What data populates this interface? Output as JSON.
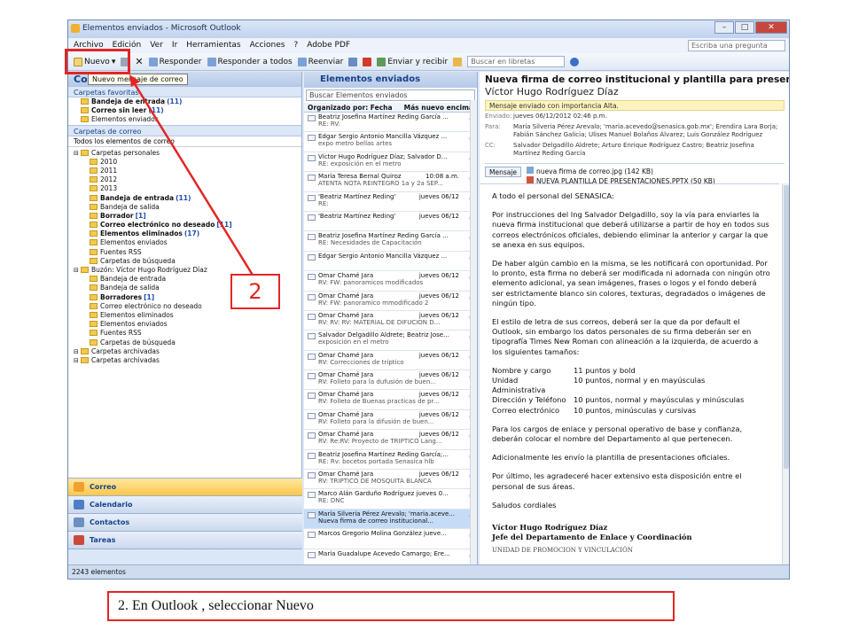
{
  "window": {
    "title": "Elementos enviados - Microsoft Outlook",
    "menu": [
      "Archivo",
      "Edición",
      "Ver",
      "Ir",
      "Herramientas",
      "Acciones",
      "?",
      "Adobe PDF"
    ],
    "ask_placeholder": "Escriba una pregunta"
  },
  "toolbar": {
    "new_label": "Nuevo",
    "reply_label": "Responder",
    "reply_all_label": "Responder a todos",
    "forward_label": "Reenviar",
    "send_receive_label": "Enviar y recibir",
    "search_books_placeholder": "Buscar en libretas",
    "tooltip": "Nuevo mensaje de correo"
  },
  "nav": {
    "header": "Correo",
    "favorites_header": "Carpetas favoritas",
    "favorites": [
      {
        "label": "Bandeja de entrada",
        "count": "(11)"
      },
      {
        "label": "Correo sin leer",
        "count": "(11)"
      },
      {
        "label": "Elementos enviados",
        "count": ""
      }
    ],
    "mail_header": "Carpetas de correo",
    "all_items": "Todos los elementos de correo",
    "tree": [
      {
        "label": "Carpetas personales",
        "indent": 1,
        "bold": false,
        "count": ""
      },
      {
        "label": "2010",
        "indent": 2,
        "bold": false,
        "count": ""
      },
      {
        "label": "2011",
        "indent": 2,
        "bold": false,
        "count": ""
      },
      {
        "label": "2012",
        "indent": 2,
        "bold": false,
        "count": ""
      },
      {
        "label": "2013",
        "indent": 2,
        "bold": false,
        "count": ""
      },
      {
        "label": "Bandeja de entrada",
        "indent": 2,
        "bold": true,
        "count": "(11)"
      },
      {
        "label": "Bandeja de salida",
        "indent": 2,
        "bold": false,
        "count": ""
      },
      {
        "label": "Borrador",
        "indent": 2,
        "bold": true,
        "count": "[1]"
      },
      {
        "label": "Correo electrónico no deseado",
        "indent": 2,
        "bold": true,
        "count": "[11]"
      },
      {
        "label": "Elementos eliminados",
        "indent": 2,
        "bold": true,
        "count": "(17)"
      },
      {
        "label": "Elementos enviados",
        "indent": 2,
        "bold": false,
        "count": ""
      },
      {
        "label": "Fuentes RSS",
        "indent": 2,
        "bold": false,
        "count": ""
      },
      {
        "label": "Carpetas de búsqueda",
        "indent": 2,
        "bold": false,
        "count": ""
      },
      {
        "label": "Buzón: Víctor Hugo Rodríguez Díaz",
        "indent": 1,
        "bold": false,
        "count": ""
      },
      {
        "label": "Bandeja de entrada",
        "indent": 2,
        "bold": false,
        "count": ""
      },
      {
        "label": "Bandeja de salida",
        "indent": 2,
        "bold": false,
        "count": ""
      },
      {
        "label": "Borradores",
        "indent": 2,
        "bold": true,
        "count": "[1]"
      },
      {
        "label": "Correo electrónico no deseado",
        "indent": 2,
        "bold": false,
        "count": ""
      },
      {
        "label": "Elementos eliminados",
        "indent": 2,
        "bold": false,
        "count": ""
      },
      {
        "label": "Elementos enviados",
        "indent": 2,
        "bold": false,
        "count": ""
      },
      {
        "label": "Fuentes RSS",
        "indent": 2,
        "bold": false,
        "count": ""
      },
      {
        "label": "Carpetas de búsqueda",
        "indent": 2,
        "bold": false,
        "count": ""
      },
      {
        "label": "Carpetas archivadas",
        "indent": 1,
        "bold": false,
        "count": ""
      },
      {
        "label": "Carpetas archivadas",
        "indent": 1,
        "bold": false,
        "count": ""
      }
    ],
    "buttons": [
      {
        "label": "Correo",
        "color": "#f0a030"
      },
      {
        "label": "Calendario",
        "color": "#4d7fc6"
      },
      {
        "label": "Contactos",
        "color": "#6c8fbf"
      },
      {
        "label": "Tareas",
        "color": "#c94a3a"
      }
    ]
  },
  "list": {
    "header": "Elementos enviados",
    "search_placeholder": "Buscar Elementos enviados",
    "arrange_by": "Organizado por: Fecha",
    "sort": "Más nuevo encima",
    "messages": [
      {
        "from": "Beatriz Josefina Martínez Reding García ...",
        "date": "",
        "subject": "RE: RV:"
      },
      {
        "from": "Edgar Sergio Antonio Mancilla Vázquez ...",
        "date": "",
        "subject": "expo metro bellas artes"
      },
      {
        "from": "Víctor Hugo Rodríguez Díaz; Salvador D...",
        "date": "",
        "subject": "RE: exposición en el metro"
      },
      {
        "from": "María Teresa Bernal Quiroz",
        "date": "10:08 a.m.",
        "subject": "ATENTA NOTA REINTEGRO 1a y 2a SEP..."
      },
      {
        "from": "'Beatriz Martínez Reding'",
        "date": "jueves 06/12",
        "subject": "RE:"
      },
      {
        "from": "'Beatriz Martínez Reding'",
        "date": "jueves 06/12",
        "subject": ""
      },
      {
        "from": "Beatriz Josefina Martínez Reding García ...",
        "date": "",
        "subject": "RE: Necesidades de Capacitación"
      },
      {
        "from": "Edgar Sergio Antonio Mancilla Vázquez ...",
        "date": "",
        "subject": ""
      },
      {
        "from": "Omar Chamé Jara",
        "date": "jueves 06/12",
        "subject": "RV: FW: panoramicos modificados"
      },
      {
        "from": "Omar Chamé Jara",
        "date": "jueves 06/12",
        "subject": "RV: FW: panoramico mmodificado 2"
      },
      {
        "from": "Omar Chamé Jara",
        "date": "jueves 06/12",
        "subject": "RV: RV: RV: MATERIAL DE DIFUCION D..."
      },
      {
        "from": "Salvador Delgadillo Aldrete; Beatriz Jose...",
        "date": "",
        "subject": "exposición en el metro"
      },
      {
        "from": "Omar Chamé Jara",
        "date": "jueves 06/12",
        "subject": "RV: Correcciones de triptico"
      },
      {
        "from": "Omar Chamé Jara",
        "date": "jueves 06/12",
        "subject": "RV: Folleto para la dufusión de buen..."
      },
      {
        "from": "Omar Chamé Jara",
        "date": "jueves 06/12",
        "subject": "RV: Folleto de Buenas practicas de pr..."
      },
      {
        "from": "Omar Chamé Jara",
        "date": "jueves 06/12",
        "subject": "RV: Folleto para la difusión de buen..."
      },
      {
        "from": "Omar Chamé Jara",
        "date": "jueves 06/12",
        "subject": "RV: Re:RV: Proyecto de TRIPTICO Lang..."
      },
      {
        "from": "Beatriz Josefina Martínez Reding García;...",
        "date": "",
        "subject": "RE: Rv: bocetos portada Senasica hlb"
      },
      {
        "from": "Omar Chamé Jara",
        "date": "jueves 06/12",
        "subject": "RV: TRIPTICO DE MOSQUITA BLANCA"
      },
      {
        "from": "Marco Alán Garduño Rodríguez jueves 0...",
        "date": "",
        "subject": "RE: DNC"
      },
      {
        "from": "María Silveria Pérez Arevalo; 'maria.aceve...",
        "date": "",
        "subject": "Nueva firma de correo institucional..."
      },
      {
        "from": "Marcos Gregorio Molina González jueve...",
        "date": "",
        "subject": ""
      },
      {
        "from": "María Guadalupe Acevedo Camargo; Ere...",
        "date": "",
        "subject": ""
      }
    ],
    "selected_index": 20
  },
  "reading": {
    "subject": "Nueva firma de correo institucional y plantilla para presentaciones",
    "sender": "Víctor Hugo Rodríguez Díaz",
    "importance": "Mensaje enviado con importancia Alta.",
    "sent_label": "Enviado:",
    "sent": "jueves 06/12/2012 02:46 p.m.",
    "to_label": "Para:",
    "to": "María Silveria Pérez Arevalo; 'maria.acevedo@senasica.gob.mx'; Erendira Lara Borja; Fabián Sánchez Galicia; Ulises Manuel Bolaños Álvarez; Luis González Rodríguez",
    "cc_label": "CC:",
    "cc": "Salvador Delgadillo Aldrete; Arturo Enrique Rodríguez Castro; Beatriz Josefina Martínez Reding García",
    "message_tab": "Mensaje",
    "attachment1": "nueva firma de correo.jpg (142 KB)",
    "attachment2": "NUEVA PLANTILLA DE PRESENTACIONES.PPTX (50 KB)",
    "body": {
      "greeting": "A todo el personal del SENASICA:",
      "p1": "Por instrucciones del Ing Salvador Delgadillo, soy la vía para enviarles la nueva firma institucional que deberá utilizarse a partir de hoy en todos sus correos electrónicos oficiales, debiendo eliminar la anterior y cargar la que se anexa en sus equipos.",
      "p2": "De haber algún cambio en la misma, se les notificará con oportunidad. Por lo pronto, esta firma no deberá ser modificada ni adornada con ningún otro elemento adicional, ya sean imágenes, frases o logos y el fondo deberá ser estrictamente blanco sin colores, texturas, degradados o imágenes de ningún tipo.",
      "p3": "El estilo de letra de sus correos, deberá ser la que da por default el Outlook, sin embargo los datos personales de su firma deberán ser en tipografía Times New Roman con alineación a la izquierda, de acuerdo a los siguientes tamaños:",
      "sizes": [
        {
          "field": "Nombre y cargo",
          "size": "11 puntos y bold"
        },
        {
          "field": "Unidad Administrativa",
          "size": "10 puntos, normal y en mayúsculas"
        },
        {
          "field": "Dirección y Teléfono",
          "size": "10 puntos, normal y mayúsculas y minúsculas"
        },
        {
          "field": "Correo electrónico",
          "size": "10 puntos, minúsculas y cursivas"
        }
      ],
      "p4": "Para los cargos de enlace y personal operativo de base y confianza, deberán colocar el nombre del Departamento al que pertenecen.",
      "p5": "Adicionalmente les envío la plantilla de presentaciones oficiales.",
      "p6": "Por último, les agradeceré hacer extensivo esta disposición entre el personal de sus áreas.",
      "closing": "Saludos cordiales",
      "sig_name": "Víctor Hugo Rodríguez Díaz",
      "sig_title": "Jefe del Departamento de Enlace y Coordinación",
      "sig_unit": "UNIDAD DE PROMOCION Y VINCULACIÓN"
    }
  },
  "status": {
    "items": "2243 elementos"
  },
  "annotation": {
    "step_number": "2",
    "caption": "2. En Outlook , seleccionar Nuevo",
    "color": "#e32525"
  }
}
